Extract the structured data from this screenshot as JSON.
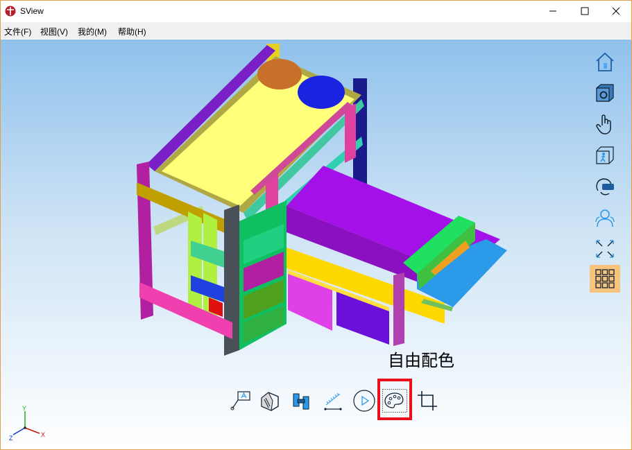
{
  "window": {
    "title": "SView"
  },
  "menu": [
    "文件(F)",
    "视图(V)",
    "我的(M)",
    "帮助(H)"
  ],
  "side_tools": [
    {
      "icon": "home-icon"
    },
    {
      "icon": "cube-gear-icon"
    },
    {
      "icon": "hand-icon"
    },
    {
      "icon": "walkthrough-icon"
    },
    {
      "icon": "vr-headset-icon"
    },
    {
      "icon": "users-icon"
    },
    {
      "icon": "explode-icon"
    },
    {
      "icon": "grid-menu-icon",
      "active": true
    }
  ],
  "bottom_tools": [
    {
      "icon": "annotation-icon"
    },
    {
      "icon": "section-icon"
    },
    {
      "icon": "measure-shape-icon"
    },
    {
      "icon": "measure-ruler-icon"
    },
    {
      "icon": "play-icon"
    },
    {
      "icon": "palette-icon",
      "selected": true
    },
    {
      "icon": "crop-icon"
    }
  ],
  "tooltip": "自由配色",
  "axis": {
    "x": "X",
    "y": "Y",
    "z": "Z"
  },
  "colors": {
    "highlight": "#e8101a",
    "active": "#f7c47d"
  }
}
